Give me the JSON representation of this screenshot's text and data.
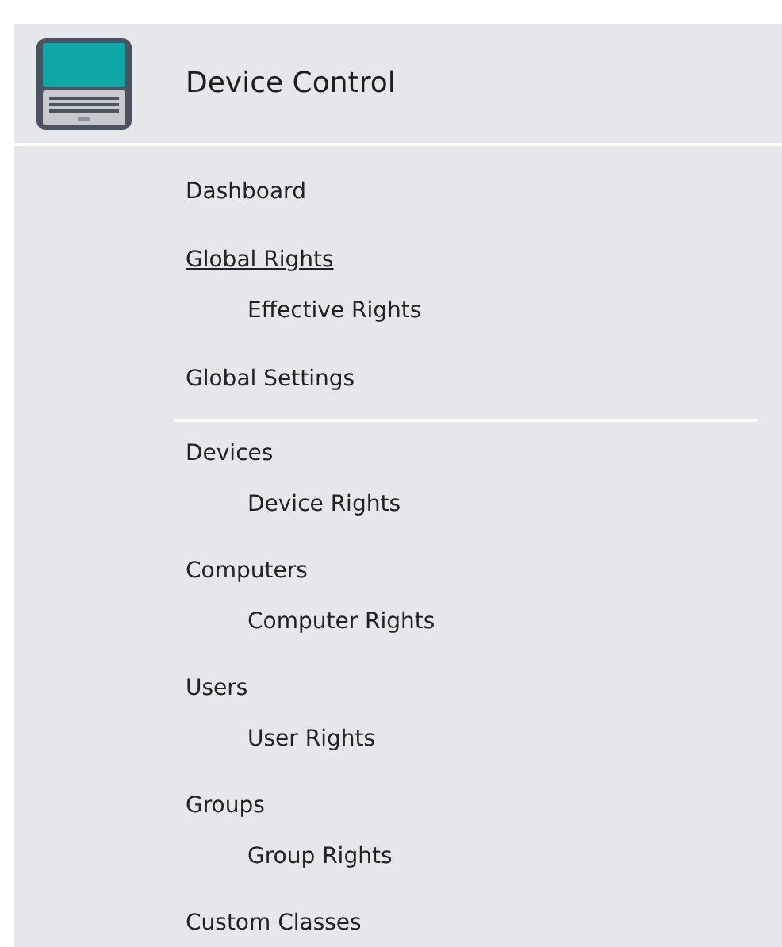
{
  "header": {
    "title": "Device Control"
  },
  "sections": [
    {
      "groups": [
        {
          "label": "Dashboard",
          "selected": false
        },
        {
          "label": "Global Rights",
          "selected": true,
          "children": [
            {
              "label": "Effective Rights",
              "selected": false
            }
          ]
        },
        {
          "label": "Global Settings",
          "selected": false
        }
      ]
    },
    {
      "groups": [
        {
          "label": "Devices",
          "selected": false,
          "children": [
            {
              "label": "Device Rights",
              "selected": false
            }
          ]
        },
        {
          "label": "Computers",
          "selected": false,
          "children": [
            {
              "label": "Computer Rights",
              "selected": false
            }
          ]
        },
        {
          "label": "Users",
          "selected": false,
          "children": [
            {
              "label": "User Rights",
              "selected": false
            }
          ]
        },
        {
          "label": "Groups",
          "selected": false,
          "children": [
            {
              "label": "Group Rights",
              "selected": false
            }
          ]
        },
        {
          "label": "Custom Classes",
          "selected": false
        }
      ]
    }
  ]
}
